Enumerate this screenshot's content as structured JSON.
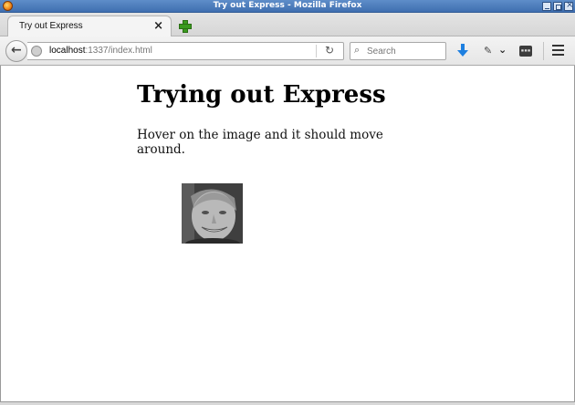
{
  "window": {
    "title": "Try out Express - Mozilla Firefox"
  },
  "tabs": [
    {
      "label": "Try out Express"
    }
  ],
  "navbar": {
    "url_host": "localhost",
    "url_path": ":1337/index.html",
    "search_placeholder": "Search"
  },
  "page": {
    "heading": "Trying out Express",
    "description": "Hover on the image and it should move around."
  },
  "icons": {
    "tab_close": "close-icon",
    "new_tab": "plus-icon",
    "back": "back-arrow-icon",
    "reload": "reload-icon",
    "search": "search-icon",
    "download": "download-icon",
    "menu": "hamburger-menu-icon"
  },
  "colors": {
    "titlebar": "#3f6fb0",
    "download_accent": "#1d7fe0",
    "new_tab_green": "#3a9a1e"
  }
}
